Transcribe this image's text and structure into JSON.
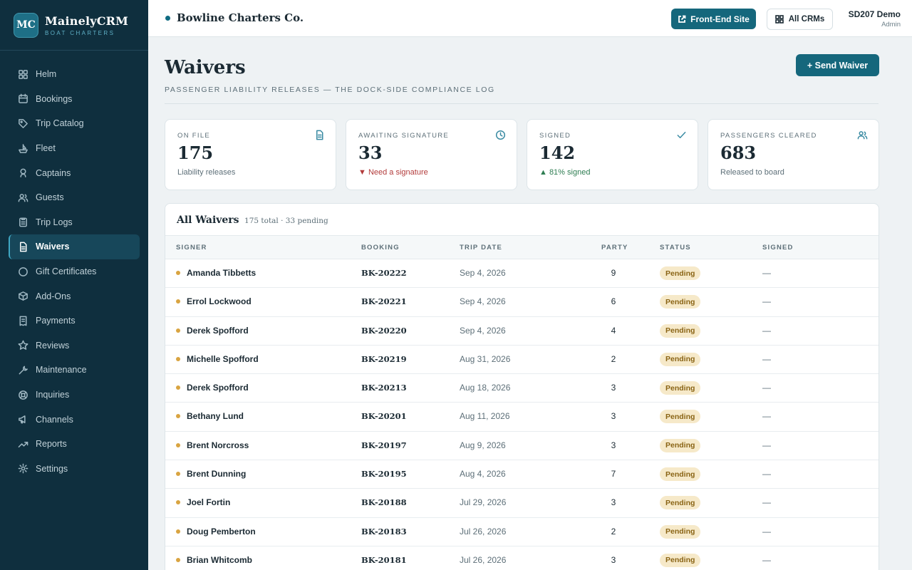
{
  "brand": {
    "badge": "MC",
    "name": "MainelyCRM",
    "sub": "BOAT CHARTERS"
  },
  "nav": [
    {
      "label": "Helm",
      "icon": "grid-icon"
    },
    {
      "label": "Bookings",
      "icon": "calendar-icon"
    },
    {
      "label": "Trip Catalog",
      "icon": "tag-icon"
    },
    {
      "label": "Fleet",
      "icon": "boat-icon"
    },
    {
      "label": "Captains",
      "icon": "captain-icon"
    },
    {
      "label": "Guests",
      "icon": "users-icon"
    },
    {
      "label": "Trip Logs",
      "icon": "clipboard-icon"
    },
    {
      "label": "Waivers",
      "icon": "document-icon"
    },
    {
      "label": "Gift Certificates",
      "icon": "circle-icon"
    },
    {
      "label": "Add-Ons",
      "icon": "box-icon"
    },
    {
      "label": "Payments",
      "icon": "receipt-icon"
    },
    {
      "label": "Reviews",
      "icon": "star-icon"
    },
    {
      "label": "Maintenance",
      "icon": "wrench-icon"
    },
    {
      "label": "Inquiries",
      "icon": "lifebuoy-icon"
    },
    {
      "label": "Channels",
      "icon": "megaphone-icon"
    },
    {
      "label": "Reports",
      "icon": "trend-icon"
    },
    {
      "label": "Settings",
      "icon": "gear-icon"
    }
  ],
  "topbar": {
    "company": "Bowline Charters Co.",
    "front_end_label": "Front-End Site",
    "all_crms_label": "All CRMs",
    "user_name": "SD207 Demo",
    "user_role": "Admin"
  },
  "page": {
    "title": "Waivers",
    "subtitle": "PASSENGER LIABILITY RELEASES — THE DOCK-SIDE COMPLIANCE LOG",
    "send_label": "+ Send Waiver"
  },
  "stats": [
    {
      "label": "ON FILE",
      "value": "175",
      "note": "Liability releases",
      "icon": "document-icon"
    },
    {
      "label": "AWAITING SIGNATURE",
      "value": "33",
      "note": "▼ Need a signature",
      "icon": "clock-icon"
    },
    {
      "label": "SIGNED",
      "value": "142",
      "note": "▲ 81% signed",
      "icon": "check-icon"
    },
    {
      "label": "PASSENGERS CLEARED",
      "value": "683",
      "note": "Released to board",
      "icon": "users-icon"
    }
  ],
  "table": {
    "title": "All Waivers",
    "meta": "175 total · 33 pending",
    "columns": [
      "SIGNER",
      "BOOKING",
      "TRIP DATE",
      "PARTY",
      "STATUS",
      "SIGNED"
    ],
    "rows": [
      {
        "signer": "Amanda Tibbetts",
        "booking": "BK-20222",
        "date": "Sep 4, 2026",
        "party": "9",
        "status": "Pending",
        "signed": "—"
      },
      {
        "signer": "Errol Lockwood",
        "booking": "BK-20221",
        "date": "Sep 4, 2026",
        "party": "6",
        "status": "Pending",
        "signed": "—"
      },
      {
        "signer": "Derek Spofford",
        "booking": "BK-20220",
        "date": "Sep 4, 2026",
        "party": "4",
        "status": "Pending",
        "signed": "—"
      },
      {
        "signer": "Michelle Spofford",
        "booking": "BK-20219",
        "date": "Aug 31, 2026",
        "party": "2",
        "status": "Pending",
        "signed": "—"
      },
      {
        "signer": "Derek Spofford",
        "booking": "BK-20213",
        "date": "Aug 18, 2026",
        "party": "3",
        "status": "Pending",
        "signed": "—"
      },
      {
        "signer": "Bethany Lund",
        "booking": "BK-20201",
        "date": "Aug 11, 2026",
        "party": "3",
        "status": "Pending",
        "signed": "—"
      },
      {
        "signer": "Brent Norcross",
        "booking": "BK-20197",
        "date": "Aug 9, 2026",
        "party": "3",
        "status": "Pending",
        "signed": "—"
      },
      {
        "signer": "Brent Dunning",
        "booking": "BK-20195",
        "date": "Aug 4, 2026",
        "party": "7",
        "status": "Pending",
        "signed": "—"
      },
      {
        "signer": "Joel Fortin",
        "booking": "BK-20188",
        "date": "Jul 29, 2026",
        "party": "3",
        "status": "Pending",
        "signed": "—"
      },
      {
        "signer": "Doug Pemberton",
        "booking": "BK-20183",
        "date": "Jul 26, 2026",
        "party": "2",
        "status": "Pending",
        "signed": "—"
      },
      {
        "signer": "Brian Whitcomb",
        "booking": "BK-20181",
        "date": "Jul 26, 2026",
        "party": "3",
        "status": "Pending",
        "signed": "—"
      }
    ]
  }
}
